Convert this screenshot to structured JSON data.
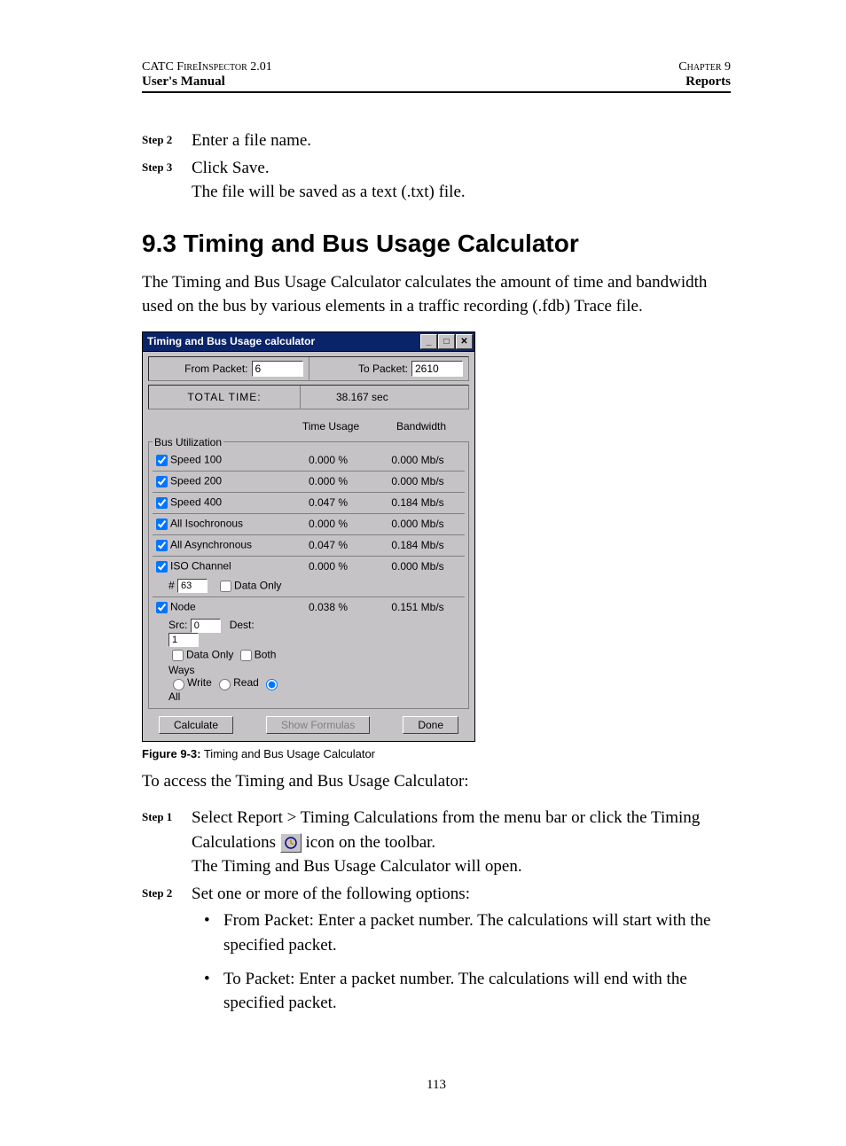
{
  "header": {
    "left1": "CATC FireInspector 2.01",
    "right1": "Chapter 9",
    "left2": "User's Manual",
    "right2": "Reports"
  },
  "steps_top": {
    "s2_label": "Step 2",
    "s2_text": "Enter a file name.",
    "s3_label": "Step 3",
    "s3_text1": "Click Save.",
    "s3_text2": "The file will be saved as a text (.txt) file."
  },
  "heading": "9.3  Timing and Bus Usage Calculator",
  "intro": "The Timing and Bus Usage Calculator calculates the amount of time and bandwidth used on the bus by various elements in a traffic recording (.fdb) Trace file.",
  "win": {
    "title": "Timing and Bus Usage calculator",
    "from_label": "From Packet:",
    "from_value": "6",
    "to_label": "To Packet:",
    "to_value": "2610",
    "total_label": "TOTAL TIME:",
    "total_value": "38.167 sec",
    "col_time": "Time Usage",
    "col_bw": "Bandwidth",
    "bus_legend": "Bus Utilization",
    "rows": [
      {
        "label": "Speed 100",
        "time": "0.000 %",
        "bw": "0.000 Mb/s"
      },
      {
        "label": "Speed 200",
        "time": "0.000 %",
        "bw": "0.000 Mb/s"
      },
      {
        "label": "Speed 400",
        "time": "0.047 %",
        "bw": "0.184 Mb/s"
      },
      {
        "label": "All Isochronous",
        "time": "0.000 %",
        "bw": "0.000 Mb/s"
      },
      {
        "label": "All Asynchronous",
        "time": "0.047 %",
        "bw": "0.184 Mb/s"
      }
    ],
    "iso_label": "ISO Channel",
    "iso_num_label": "#",
    "iso_num_value": "63",
    "iso_dataonly": "Data Only",
    "iso_time": "0.000 %",
    "iso_bw": "0.000 Mb/s",
    "node_label": "Node",
    "node_src_label": "Src:",
    "node_src_value": "0",
    "node_dest_label": "Dest:",
    "node_dest_value": "1",
    "node_dataonly": "Data Only",
    "node_bothways": "Both Ways",
    "radio_write": "Write",
    "radio_read": "Read",
    "radio_all": "All",
    "node_time": "0.038 %",
    "node_bw": "0.151 Mb/s",
    "btn_calc": "Calculate",
    "btn_formulas": "Show Formulas",
    "btn_done": "Done"
  },
  "fig": {
    "label": "Figure 9-3:",
    "text": "  Timing and Bus Usage Calculator"
  },
  "access_intro": "To access the Timing and Bus Usage Calculator:",
  "access_steps": {
    "s1_label": "Step 1",
    "s1_text_a": "Select Report > Timing Calculations from the menu bar or click the Timing Calculations ",
    "s1_text_b": " icon on the toolbar.",
    "s1_text2": "The Timing and Bus Usage Calculator will open.",
    "s2_label": "Step 2",
    "s2_text": "Set one or more of the following options:"
  },
  "bullets": {
    "b1": "From Packet: Enter a packet number. The calculations will start with the specified packet.",
    "b2": "To Packet: Enter a packet number. The calculations will end with the specified packet."
  },
  "page_number": "113"
}
